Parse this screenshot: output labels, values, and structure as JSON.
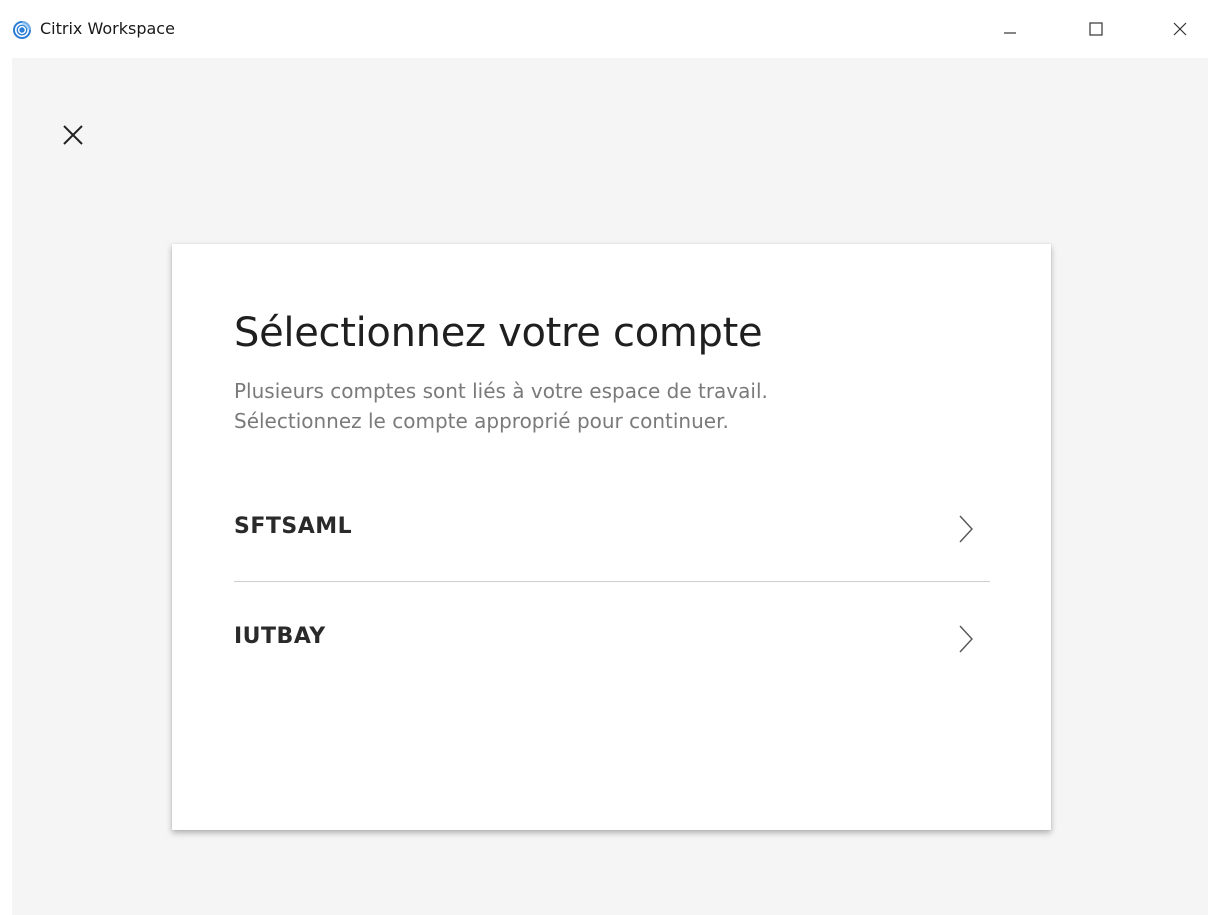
{
  "window": {
    "title": "Citrix Workspace",
    "icon": "citrix-icon",
    "controls": [
      "minimize-icon",
      "maximize-icon",
      "close-icon"
    ]
  },
  "dialog": {
    "close_icon": "close-icon",
    "title": "Sélectionnez votre compte",
    "subtitle_line1": "Plusieurs comptes sont liés à votre espace de travail.",
    "subtitle_line2": "Sélectionnez le compte approprié pour continuer.",
    "accounts": [
      {
        "label": "SFTSAML",
        "icon": "chevron-right-icon"
      },
      {
        "label": "IUTBAY",
        "icon": "chevron-right-icon"
      }
    ]
  },
  "colors": {
    "accent": "#2b7fd6",
    "background": "#f5f5f5",
    "card": "#ffffff",
    "title_text": "#1f1f1f",
    "subtitle_text": "#7a7a7a"
  }
}
